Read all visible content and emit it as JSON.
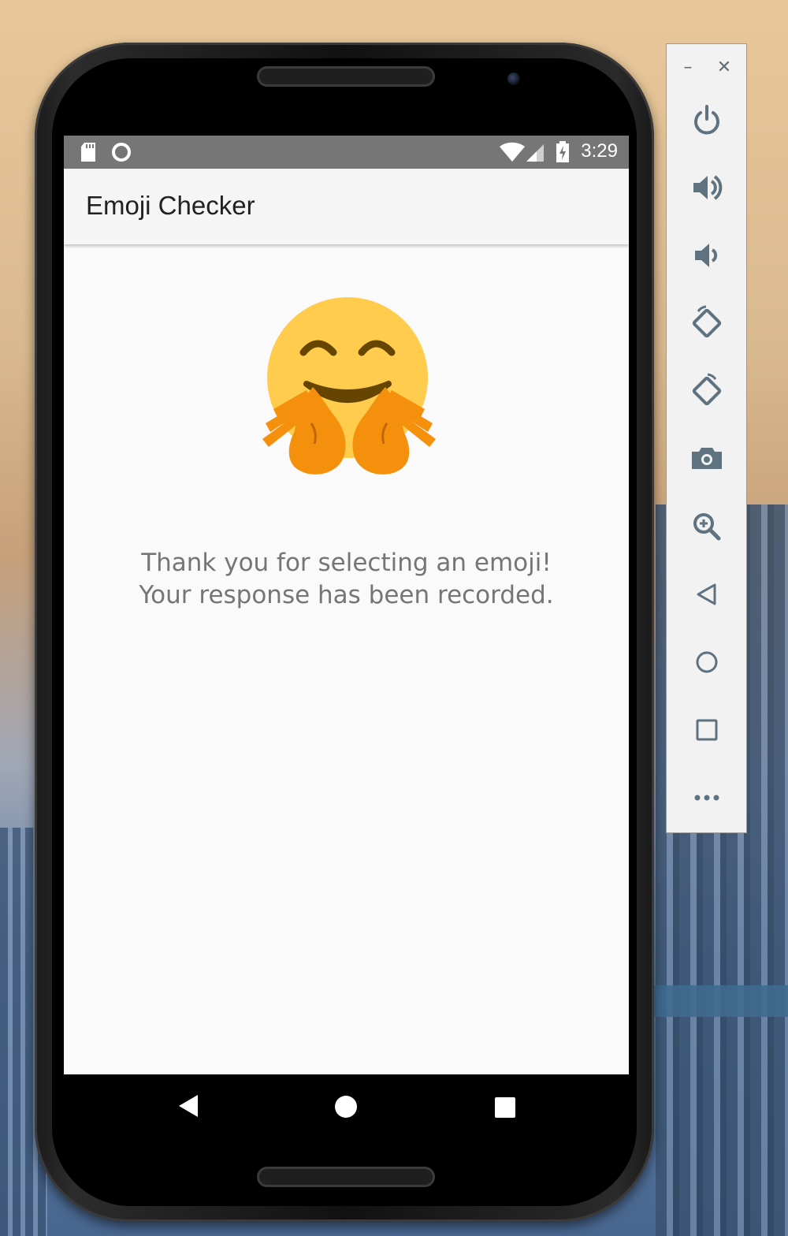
{
  "status_bar": {
    "time": "3:29",
    "icons": [
      "sd-card-icon",
      "sync-circle-icon",
      "wifi-icon",
      "signal-icon",
      "battery-charging-icon"
    ]
  },
  "app": {
    "title": "Emoji Checker",
    "emoji": "hugging-face-emoji",
    "message_line1": "Thank you for selecting an emoji!",
    "message_line2": "Your response has been recorded."
  },
  "nav_bar": {
    "buttons": [
      "back-icon",
      "home-icon",
      "recents-icon"
    ]
  },
  "emulator_toolbar": {
    "window_controls": [
      "minimize-icon",
      "close-icon"
    ],
    "minimize_glyph": "–",
    "close_glyph": "✕",
    "buttons": [
      "power-icon",
      "volume-up-icon",
      "volume-down-icon",
      "rotate-left-icon",
      "rotate-right-icon",
      "camera-icon",
      "zoom-icon",
      "back-icon",
      "home-icon",
      "overview-icon",
      "more-icon"
    ]
  },
  "colors": {
    "status_bar": "#767676",
    "app_bar": "#f5f5f5",
    "screen_bg": "#fafafa",
    "message_text": "#757575",
    "toolbar_icon": "#5f7280",
    "emoji_face": "#ffcc4d",
    "emoji_hands": "#f4900c"
  }
}
